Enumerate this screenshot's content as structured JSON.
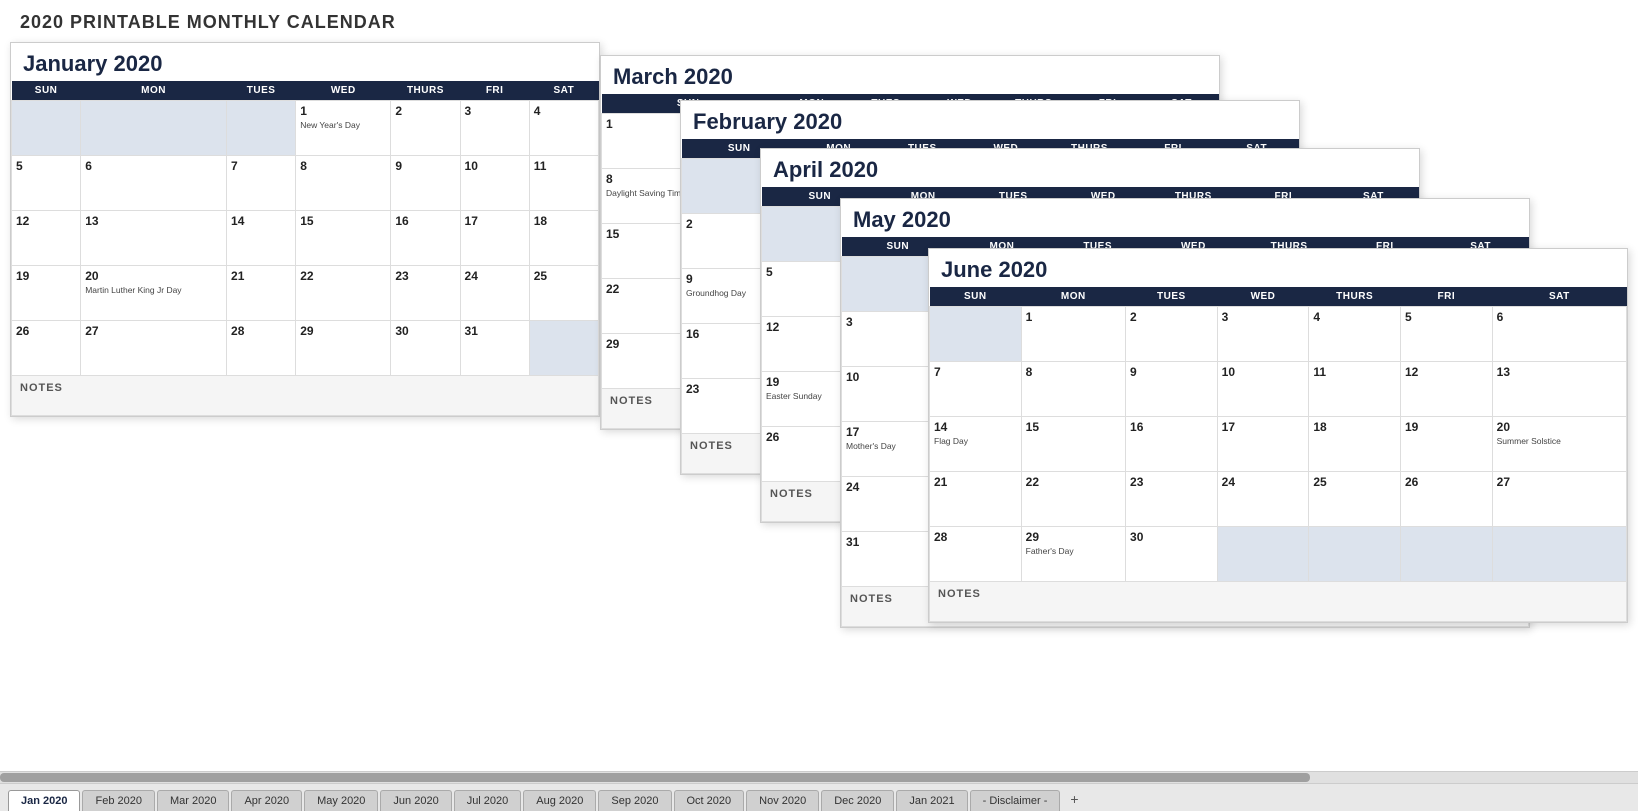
{
  "page": {
    "title": "2020 PRINTABLE MONTHLY CALENDAR"
  },
  "calendars": {
    "january": {
      "title": "January 2020",
      "headers": [
        "SUN",
        "MON",
        "TUES",
        "WED",
        "THURS",
        "FRI",
        "SAT"
      ],
      "weeks": [
        [
          {
            "empty": true
          },
          {
            "empty": true
          },
          {
            "empty": true
          },
          {
            "d": "1",
            "h": "New Year's Day"
          },
          {
            "d": "2"
          },
          {
            "d": "3"
          },
          {
            "d": "4"
          }
        ],
        [
          {
            "d": "5"
          },
          {
            "d": "6"
          },
          {
            "d": "7"
          },
          {
            "d": "8"
          },
          {
            "d": "9"
          },
          {
            "d": "10"
          },
          {
            "d": "11"
          }
        ],
        [
          {
            "d": "12"
          },
          {
            "d": "13"
          },
          {
            "d": "14"
          },
          {
            "d": "15"
          },
          {
            "d": "16"
          },
          {
            "d": "17"
          },
          {
            "d": "18"
          }
        ],
        [
          {
            "d": "19"
          },
          {
            "d": "20",
            "h": "Martin Luther King Jr Day"
          },
          {
            "d": "21"
          },
          {
            "d": "22"
          },
          {
            "d": "23"
          },
          {
            "d": "24"
          },
          {
            "d": "25"
          }
        ],
        [
          {
            "d": "26"
          },
          {
            "d": "27"
          },
          {
            "d": "28"
          },
          {
            "d": "29"
          },
          {
            "d": "30"
          },
          {
            "d": "31"
          },
          {
            "empty": true
          }
        ]
      ],
      "notes": "NOTES"
    },
    "june": {
      "title": "June 2020",
      "headers": [
        "SUN",
        "MON",
        "TUES",
        "WED",
        "THURS",
        "FRI",
        "SAT"
      ],
      "weeks": [
        [
          {
            "empty": true
          },
          {
            "d": "1"
          },
          {
            "d": "2"
          },
          {
            "d": "3"
          },
          {
            "d": "4"
          },
          {
            "d": "5"
          },
          {
            "d": "6"
          }
        ],
        [
          {
            "d": "7"
          },
          {
            "d": "8"
          },
          {
            "d": "9"
          },
          {
            "d": "10"
          },
          {
            "d": "11"
          },
          {
            "d": "12"
          },
          {
            "d": "13"
          }
        ],
        [
          {
            "d": "14",
            "h": "Flag Day"
          },
          {
            "d": "15"
          },
          {
            "d": "16"
          },
          {
            "d": "17"
          },
          {
            "d": "18"
          },
          {
            "d": "19"
          },
          {
            "d": "20",
            "h": "Summer Solstice"
          }
        ],
        [
          {
            "d": "21"
          },
          {
            "d": "22"
          },
          {
            "d": "23"
          },
          {
            "d": "24"
          },
          {
            "d": "25"
          },
          {
            "d": "26"
          },
          {
            "d": "27"
          }
        ],
        [
          {
            "d": "28"
          },
          {
            "d": "29"
          },
          {
            "d": "30"
          },
          {
            "future": true
          },
          {
            "future": true
          },
          {
            "future": true
          },
          {
            "future": true
          }
        ]
      ],
      "notes": "NOTES"
    }
  },
  "tabs": [
    {
      "label": "Jan 2020",
      "active": true
    },
    {
      "label": "Feb 2020",
      "active": false
    },
    {
      "label": "Mar 2020",
      "active": false
    },
    {
      "label": "Apr 2020",
      "active": false
    },
    {
      "label": "May 2020",
      "active": false
    },
    {
      "label": "Jun 2020",
      "active": false
    },
    {
      "label": "Jul 2020",
      "active": false
    },
    {
      "label": "Aug 2020",
      "active": false
    },
    {
      "label": "Sep 2020",
      "active": false
    },
    {
      "label": "Oct 2020",
      "active": false
    },
    {
      "label": "Nov 2020",
      "active": false
    },
    {
      "label": "Dec 2020",
      "active": false
    },
    {
      "label": "Jan 2021",
      "active": false
    },
    {
      "label": "- Disclaimer -",
      "active": false
    }
  ]
}
